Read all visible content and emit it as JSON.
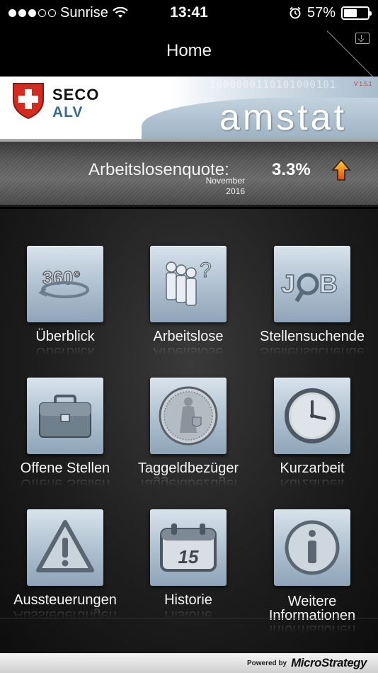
{
  "status_bar": {
    "carrier": "Sunrise",
    "time": "13:41",
    "battery_percent": "57%",
    "battery_level": 0.57,
    "signal_bars_filled": 3,
    "signal_bars_total": 5
  },
  "nav": {
    "title": "Home"
  },
  "banner": {
    "org_line1": "SECO",
    "org_line2": "ALV",
    "app_name": "amstat",
    "version": "V 1.5.1",
    "binary_decoration": "1000000110101000101"
  },
  "quote": {
    "label": "Arbeitslosenquote:",
    "value": "3.3%",
    "month": "November",
    "year": "2016",
    "trend": "up"
  },
  "tiles": [
    {
      "id": "ueberblick",
      "label": "Überblick",
      "icon": "360-rotate-icon"
    },
    {
      "id": "arbeitslose",
      "label": "Arbeitslose",
      "icon": "people-question-icon"
    },
    {
      "id": "stellensuchende",
      "label": "Stellensuchende",
      "icon": "job-search-icon"
    },
    {
      "id": "offene-stellen",
      "label": "Offene Stellen",
      "icon": "briefcase-icon"
    },
    {
      "id": "taggeldbezueger",
      "label": "Taggeldbezüger",
      "icon": "swiss-coin-icon"
    },
    {
      "id": "kurzarbeit",
      "label": "Kurzarbeit",
      "icon": "clock-icon"
    },
    {
      "id": "aussteuerungen",
      "label": "Aussteuerungen",
      "icon": "warning-icon"
    },
    {
      "id": "historie",
      "label": "Historie",
      "icon": "calendar-icon",
      "calendar_day": "15"
    },
    {
      "id": "weitere-informationen",
      "label_line1": "Weitere",
      "label_line2": "Informationen",
      "icon": "info-icon"
    }
  ],
  "footer": {
    "powered_by": "Powered by",
    "brand": "MicroStrategy"
  },
  "colors": {
    "accent_red": "#d52b1e",
    "alv_blue": "#3a6a8c",
    "arrow_orange": "#f07d00",
    "tile_blue": "#b8c8d6"
  }
}
